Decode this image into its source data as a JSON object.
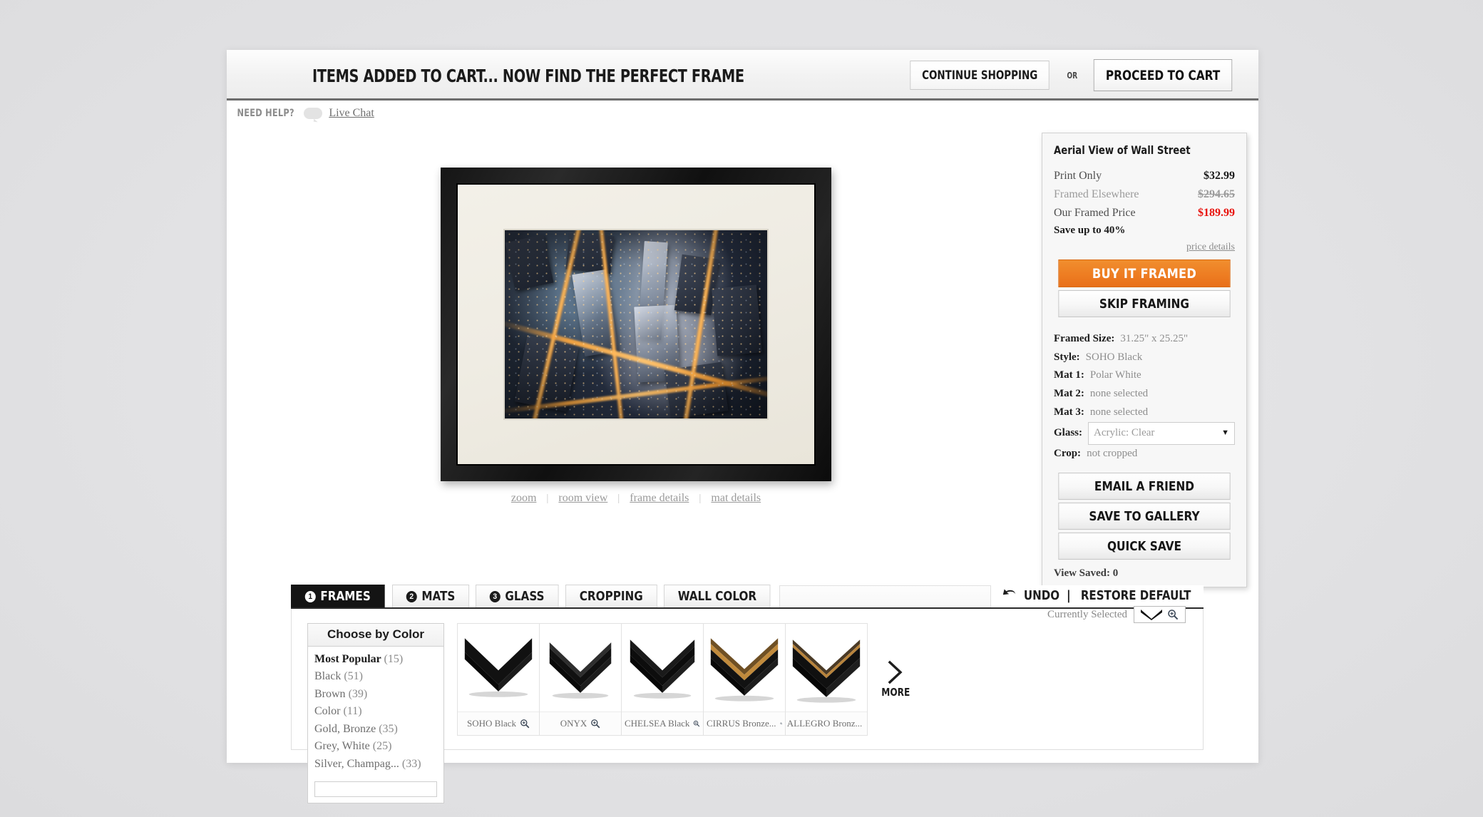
{
  "header": {
    "title": "ITEMS ADDED TO CART... NOW FIND THE PERFECT FRAME",
    "continue_shopping": "CONTINUE SHOPPING",
    "or": "OR",
    "proceed_to_cart": "PROCEED TO CART"
  },
  "help": {
    "label": "NEED HELP?",
    "live_chat": "Live Chat"
  },
  "preview": {
    "links": [
      "zoom",
      "room view",
      "frame details",
      "mat details"
    ],
    "separator": "|"
  },
  "panel": {
    "title": "Aerial View of Wall Street",
    "prices": [
      {
        "label": "Print Only",
        "amount": "$32.99",
        "style": "normal"
      },
      {
        "label": "Framed Elsewhere",
        "amount": "$294.65",
        "style": "muted"
      },
      {
        "label": "Our Framed Price",
        "amount": "$189.99",
        "style": "ours"
      }
    ],
    "save_line": "Save up to 40%",
    "price_details": "price details",
    "buy_button": "BUY IT FRAMED",
    "skip_button": "SKIP FRAMING",
    "specs": [
      {
        "key": "Framed Size:",
        "value": "31.25\" x 25.25\""
      },
      {
        "key": "Style:",
        "value": "SOHO Black"
      },
      {
        "key": "Mat 1:",
        "value": "Polar White"
      },
      {
        "key": "Mat 2:",
        "value": "none selected"
      },
      {
        "key": "Mat 3:",
        "value": "none selected"
      }
    ],
    "glass_key": "Glass:",
    "glass_value": "Acrylic: Clear",
    "crop_key": "Crop:",
    "crop_value": "not cropped",
    "email_button": "EMAIL A FRIEND",
    "save_gallery_button": "SAVE TO GALLERY",
    "quick_save_button": "QUICK SAVE",
    "view_saved": "View Saved: 0"
  },
  "tabs": [
    {
      "num": "1",
      "label": "FRAMES",
      "active": true
    },
    {
      "num": "2",
      "label": "MATS",
      "active": false
    },
    {
      "num": "3",
      "label": "GLASS",
      "active": false
    },
    {
      "num": "",
      "label": "CROPPING",
      "active": false
    },
    {
      "num": "",
      "label": "WALL COLOR",
      "active": false
    }
  ],
  "toolbar": {
    "undo": "UNDO",
    "pipe": "|",
    "restore_default": "RESTORE DEFAULT"
  },
  "frames": {
    "color_box_title": "Choose by Color",
    "colors": [
      {
        "name": "Most Popular",
        "count": "(15)",
        "selected": true
      },
      {
        "name": "Black",
        "count": "(51)",
        "selected": false
      },
      {
        "name": "Brown",
        "count": "(39)",
        "selected": false
      },
      {
        "name": "Color",
        "count": "(11)",
        "selected": false
      },
      {
        "name": "Gold, Bronze",
        "count": "(35)",
        "selected": false
      },
      {
        "name": "Grey, White",
        "count": "(25)",
        "selected": false
      },
      {
        "name": "Silver, Champag...",
        "count": "(33)",
        "selected": false
      }
    ],
    "currently_selected_label": "Currently Selected",
    "swatches": [
      {
        "name": "SOHO Black",
        "accent": "none"
      },
      {
        "name": "ONYX",
        "accent": "none"
      },
      {
        "name": "CHELSEA Black",
        "accent": "none"
      },
      {
        "name": "CIRRUS Bronze...",
        "accent": "#c08a3c"
      },
      {
        "name": "ALLEGRO Bronz...",
        "accent": "#b8843c"
      }
    ],
    "more_label": "MORE"
  },
  "colors": {
    "accent_orange": "#ee7d22",
    "price_red": "#e8120c",
    "active_tab": "#141414",
    "page_bg": "#e4e4e6"
  }
}
